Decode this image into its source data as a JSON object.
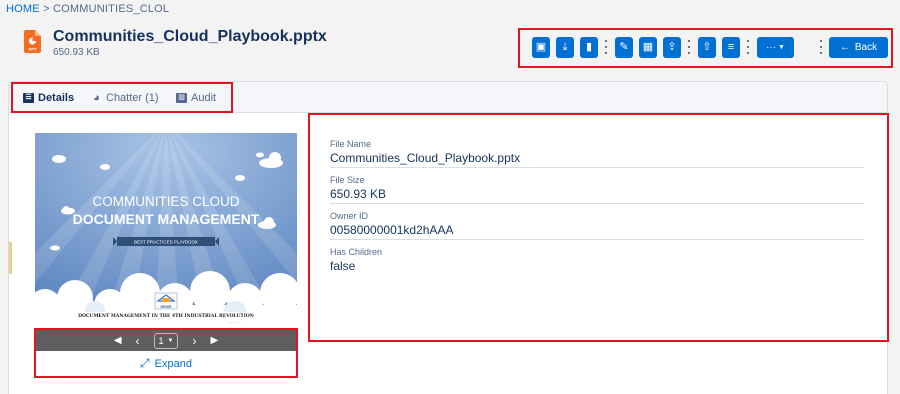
{
  "breadcrumb": {
    "home": "HOME",
    "separator": ">",
    "current": "COMMUNITIES_CLOL"
  },
  "file": {
    "name": "Communities_Cloud_Playbook.pptx",
    "size": "650.93 KB",
    "type_badge": "PPT"
  },
  "toolbar": {
    "buttons": [
      {
        "icon": "preview-icon",
        "glyph": "▣"
      },
      {
        "icon": "download-icon",
        "glyph": "⤓"
      },
      {
        "icon": "clipboard-icon",
        "glyph": "▮"
      },
      {
        "icon": "edit-icon",
        "glyph": "✎"
      },
      {
        "icon": "delete-icon",
        "glyph": "▦"
      },
      {
        "icon": "share-icon",
        "glyph": "⇪"
      },
      {
        "icon": "upload-icon",
        "glyph": "⇧"
      },
      {
        "icon": "list-icon",
        "glyph": "≡"
      }
    ],
    "more_label": "···",
    "back_label": "Back"
  },
  "tabs": [
    {
      "label": "Details",
      "active": true
    },
    {
      "label": "Chatter (1)",
      "active": false
    },
    {
      "label": "Audit",
      "active": false
    }
  ],
  "preview": {
    "title_line1": "COMMUNITIES CLOUD",
    "title_line2": "DOCUMENT MANAGEMENT",
    "banner": "BEST PRACTICES PLAYBOOK",
    "logo_text": "DRIVE",
    "footer": "DOCUMENT MANAGEMENT IN THE 4TH INDUSTRIAL REVOLUTION",
    "page": "1",
    "expand_label": "Expand"
  },
  "details": {
    "fields": [
      {
        "label": "File Name",
        "value": "Communities_Cloud_Playbook.pptx"
      },
      {
        "label": "File Size",
        "value": "650.93 KB"
      },
      {
        "label": "Owner ID",
        "value": "00580000001kd2hAAA"
      },
      {
        "label": "Has Children",
        "value": "false"
      }
    ]
  },
  "colors": {
    "accent": "#0070d2",
    "highlight": "#e0161e",
    "text": "#16325c",
    "muted": "#54698d"
  }
}
